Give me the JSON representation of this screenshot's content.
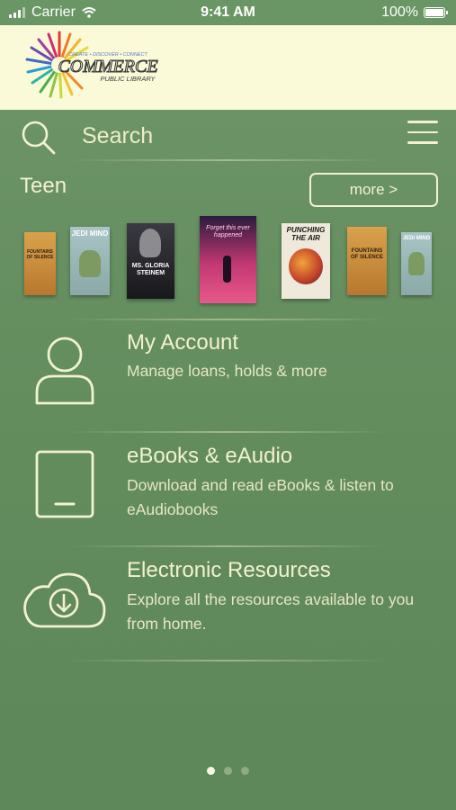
{
  "status_bar": {
    "carrier": "Carrier",
    "time": "9:41 AM",
    "battery": "100%"
  },
  "header": {
    "logo_tagline": "CREATE • DISCOVER • CONNECT",
    "logo_name": "COMMERCE",
    "logo_subname": "PUBLIC LIBRARY"
  },
  "search": {
    "label": "Search"
  },
  "teen": {
    "title": "Teen",
    "more_label": "more >",
    "books": [
      {
        "title": "FOUNTAINS OF SILENCE",
        "color": "#c9923f"
      },
      {
        "title": "JEDI MIND",
        "color": "#9ab6b8"
      },
      {
        "title": "MS. GLORIA STEINEM",
        "color": "#2a2a30"
      },
      {
        "title": "Forget this ever happened",
        "color": "#b0306a"
      },
      {
        "title": "PUNCHING THE AIR",
        "color": "#e8e2d6"
      },
      {
        "title": "FOUNTAINS OF SILENCE",
        "color": "#c9923f"
      },
      {
        "title": "JEDI MIND",
        "color": "#9ab6b8"
      }
    ]
  },
  "menu": [
    {
      "icon": "person-icon",
      "title": "My Account",
      "subtitle": "Manage loans, holds & more"
    },
    {
      "icon": "tablet-icon",
      "title": "eBooks & eAudio",
      "subtitle": "Download and read eBooks & listen to eAudiobooks"
    },
    {
      "icon": "cloud-download-icon",
      "title": "Electronic Resources",
      "subtitle": "Explore all the resources available to you from home."
    }
  ],
  "pager": {
    "count": 3,
    "active": 0
  }
}
